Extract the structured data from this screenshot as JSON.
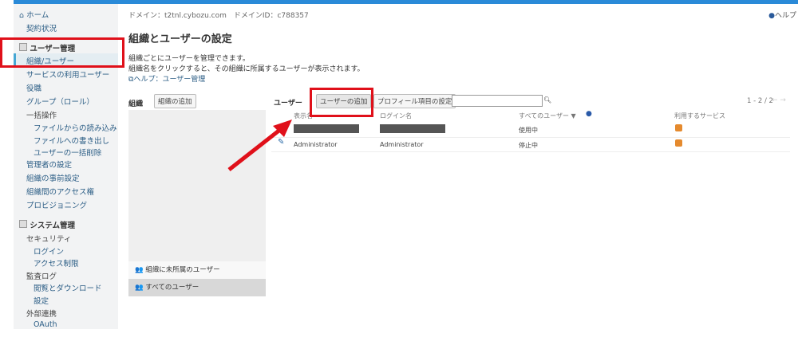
{
  "header": {
    "domain": "ドメイン：t2tnl.cybozu.com　ドメインID：c788357",
    "help": "ヘルプ"
  },
  "sidebar": {
    "home": "ホーム",
    "contract": "契約状況",
    "user_mgmt": "ユーザー管理",
    "org_user": "組織/ユーザー",
    "service_users": "サービスの利用ユーザー",
    "roles": "役職",
    "groups": "グループ（ロール）",
    "bulk": "一括操作",
    "bulk_import": "ファイルからの読み込み",
    "bulk_export": "ファイルへの書き出し",
    "bulk_delete": "ユーザーの一括削除",
    "admins": "管理者の設定",
    "org_preset": "組織の事前設定",
    "org_access": "組織間のアクセス権",
    "provisioning": "プロビジョニング",
    "sys_mgmt": "システム管理",
    "security": "セキュリティ",
    "login": "ログイン",
    "access": "アクセス制限",
    "audit": "監査ログ",
    "audit_view": "閲覧とダウンロード",
    "audit_settings": "設定",
    "external": "外部連携",
    "oauth": "OAuth"
  },
  "main": {
    "title": "組織とユーザーの設定",
    "desc1": "組織ごとにユーザーを管理できます。",
    "desc2": "組織名をクリックすると、その組織に所属するユーザーが表示されます。",
    "help_link": "ヘルプ：ユーザー管理",
    "org_label": "組織",
    "add_org": "組織の追加",
    "no_org_users": "組織に未所属のユーザー",
    "all_users": "すべてのユーザー",
    "user_label": "ユーザー",
    "add_user": "ユーザーの追加",
    "profile_settings": "プロフィール項目の設定",
    "search_value": "",
    "pagination": "1 - 2 / 2",
    "columns": [
      "表示名",
      "ログイン名",
      "すべてのユーザー ▼",
      "利用するサービス"
    ],
    "rows": [
      {
        "display": "",
        "login": "",
        "status": "使用中"
      },
      {
        "display": "Administrator",
        "login": "Administrator",
        "status": "停止中"
      }
    ]
  },
  "colors": {
    "accent": "#2a8ad8",
    "highlight": "#e0101a"
  }
}
